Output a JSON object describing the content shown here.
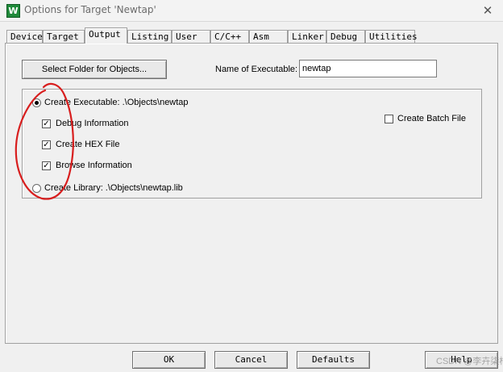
{
  "window": {
    "title": "Options for Target 'Newtap'",
    "icon_letter": "W",
    "close_glyph": "✕"
  },
  "tabs": [
    {
      "label": "Device"
    },
    {
      "label": "Target"
    },
    {
      "label": "Output",
      "active": true
    },
    {
      "label": "Listing"
    },
    {
      "label": "User"
    },
    {
      "label": "C/C++"
    },
    {
      "label": "Asm"
    },
    {
      "label": "Linker"
    },
    {
      "label": "Debug"
    },
    {
      "label": "Utilities"
    }
  ],
  "output": {
    "select_folder_label": "Select Folder for Objects...",
    "name_exec_label": "Name of Executable:",
    "name_exec_value": "newtap",
    "create_executable_label": "Create Executable:  .\\Objects\\newtap",
    "create_executable_checked": true,
    "debug_info_label": "Debug Information",
    "debug_info_checked": true,
    "hex_file_label": "Create HEX File",
    "hex_file_checked": true,
    "browse_info_label": "Browse Information",
    "browse_info_checked": true,
    "create_library_label": "Create Library:  .\\Objects\\newtap.lib",
    "create_library_checked": false,
    "batch_file_label": "Create Batch File",
    "batch_file_checked": false
  },
  "buttons": {
    "ok": "OK",
    "cancel": "Cancel",
    "defaults": "Defaults",
    "help": "Help"
  },
  "watermark": "CSDN @李卉柒梓",
  "colors": {
    "annotation": "#d81e1e",
    "dialog_bg": "#f0f0f0"
  }
}
